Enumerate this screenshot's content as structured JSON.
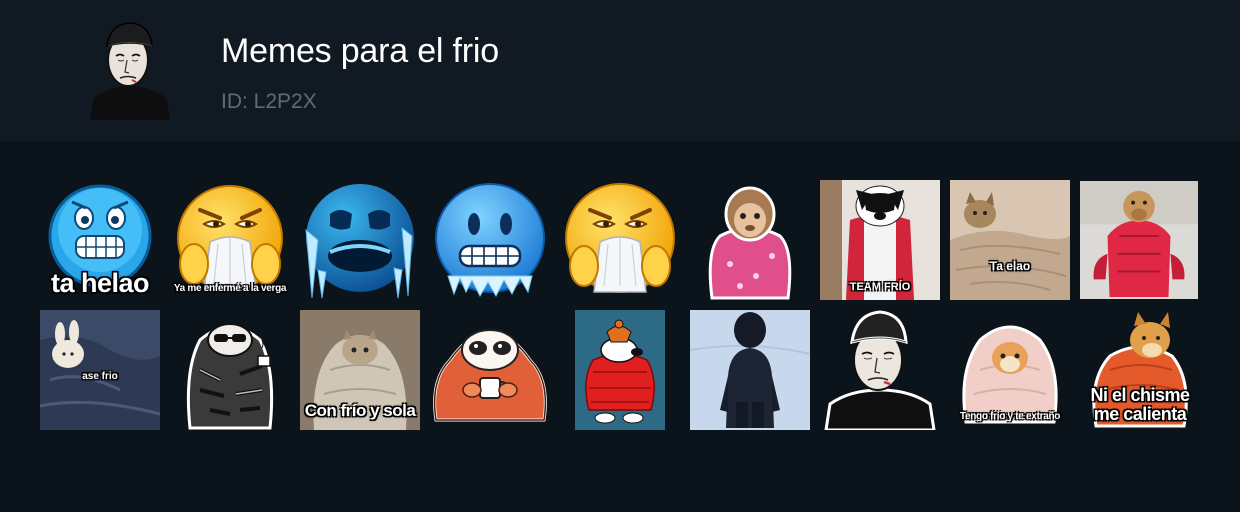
{
  "pack": {
    "title": "Memes para el frio",
    "id_label": "ID: L2P2X"
  },
  "stickers": [
    {
      "name": "sticker-freezing-emoji-ta-helao",
      "caption": "ta helao"
    },
    {
      "name": "sticker-sick-emoji-ya-me-enferme",
      "caption": "Ya me enfermé a la verga"
    },
    {
      "name": "sticker-blue-frozen-face",
      "caption": ""
    },
    {
      "name": "sticker-cold-face-emoji",
      "caption": ""
    },
    {
      "name": "sticker-sick-emoji-tissue",
      "caption": ""
    },
    {
      "name": "sticker-monkey-in-blanket",
      "caption": ""
    },
    {
      "name": "sticker-dog-team-frio",
      "caption": "TEAM FRÍO"
    },
    {
      "name": "sticker-cat-ta-elao",
      "caption": "Ta elao"
    },
    {
      "name": "sticker-dog-red-jacket",
      "caption": ""
    },
    {
      "name": "sticker-bunny-ase-frio",
      "caption": "ase frio"
    },
    {
      "name": "sticker-tiger-blanket-figure",
      "caption": ""
    },
    {
      "name": "sticker-cat-con-frio-y-sola",
      "caption": "Con frío y sola"
    },
    {
      "name": "sticker-hooded-character-mug",
      "caption": ""
    },
    {
      "name": "sticker-snoopy-red-jacket",
      "caption": ""
    },
    {
      "name": "sticker-child-in-snow",
      "caption": ""
    },
    {
      "name": "sticker-doomer-wojak",
      "caption": ""
    },
    {
      "name": "sticker-cat-tengo-frio",
      "caption": "Tengo frío y te extraño"
    },
    {
      "name": "sticker-doge-ni-el-chisme",
      "caption": "Ni el chisme me calienta"
    }
  ],
  "colors": {
    "header_bg": "#111a23",
    "body_bg": "#0b131b",
    "title": "#ffffff",
    "id_text": "#5f6b75"
  }
}
